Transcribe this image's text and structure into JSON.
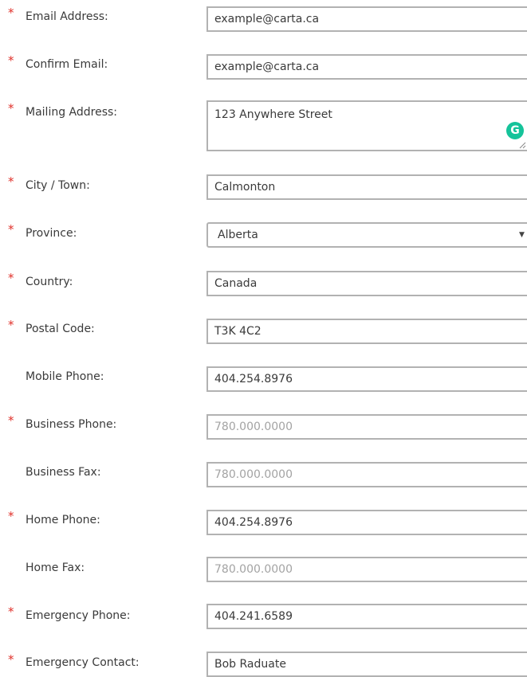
{
  "required_marker": "*",
  "colors": {
    "required": "#e0302a",
    "border": "#b2b2b2",
    "text": "#3a3a3a",
    "placeholder": "#a3a3a3",
    "grammarly": "#15c39a"
  },
  "fields": {
    "email": {
      "label": "Email Address:",
      "value": "example@carta.ca"
    },
    "confirm_email": {
      "label": "Confirm Email:",
      "value": "example@carta.ca"
    },
    "mailing_address": {
      "label": "Mailing Address:",
      "value": "123 Anywhere Street"
    },
    "city": {
      "label": "City / Town:",
      "value": "Calmonton"
    },
    "province": {
      "label": "Province:",
      "value": "Alberta"
    },
    "country": {
      "label": "Country:",
      "value": "Canada"
    },
    "postal_code": {
      "label": "Postal Code:",
      "value": "T3K 4C2"
    },
    "mobile_phone": {
      "label": "Mobile Phone:",
      "value": "404.254.8976"
    },
    "business_phone": {
      "label": "Business Phone:",
      "placeholder": "780.000.0000"
    },
    "business_fax": {
      "label": "Business Fax:",
      "placeholder": "780.000.0000"
    },
    "home_phone": {
      "label": "Home Phone:",
      "value": "404.254.8976"
    },
    "home_fax": {
      "label": "Home Fax:",
      "placeholder": "780.000.0000"
    },
    "emergency_phone": {
      "label": "Emergency Phone:",
      "value": "404.241.6589"
    },
    "emergency_contact": {
      "label": "Emergency Contact:",
      "value": "Bob Raduate"
    }
  },
  "icons": {
    "grammarly": "grammarly-icon",
    "grammarly_glyph": "G",
    "dropdown": "chevron-down-icon",
    "dropdown_glyph": "▼",
    "resize": "resize-handle-icon"
  }
}
